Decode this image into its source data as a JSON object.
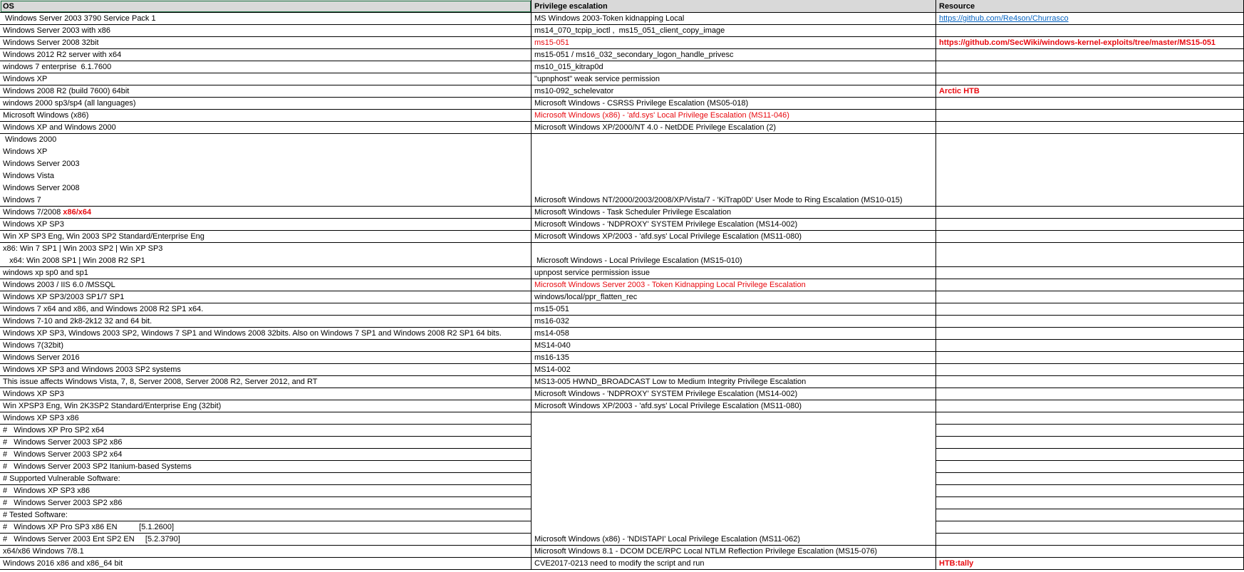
{
  "sheet": {
    "headers": [
      "OS",
      "Privilege escalation",
      "Resource"
    ],
    "rows": [
      {
        "os": [
          " Windows Server 2003 3790 Service Pack 1"
        ],
        "priv": [
          "MS Windows 2003-Token kidnapping Local"
        ],
        "res": [
          "https://github.com/Re4son/Churrasco"
        ],
        "res_style": "link"
      },
      {
        "os": [
          "Windows Server 2003 with x86"
        ],
        "priv": [
          "ms14_070_tcpip_ioctl ,  ms15_051_client_copy_image"
        ]
      },
      {
        "os": [
          "Windows Server 2008 32bit"
        ],
        "priv": [
          "ms15-051"
        ],
        "priv_style": "red",
        "res": [
          "https://github.com/SecWiki/windows-kernel-exploits/tree/master/MS15-051"
        ],
        "res_style": "redb"
      },
      {
        "os": [
          "Windows 2012 R2 server with x64"
        ],
        "priv": [
          "ms15-051 / ms16_032_secondary_logon_handle_privesc"
        ]
      },
      {
        "os": [
          "windows 7 enterprise  6.1.7600"
        ],
        "priv": [
          "ms10_015_kitrap0d"
        ]
      },
      {
        "os": [
          "Windows XP"
        ],
        "priv": [
          "\"upnphost\" weak service permission"
        ]
      },
      {
        "os": [
          "Windows 2008 R2 (build 7600) 64bit"
        ],
        "priv": [
          "ms10-092_schelevator"
        ],
        "res": [
          "Arctic HTB"
        ],
        "res_style": "redb"
      },
      {
        "os": [
          "windows 2000 sp3/sp4 (all languages)"
        ],
        "priv": [
          "Microsoft Windows - CSRSS Privilege Escalation (MS05-018)"
        ]
      },
      {
        "os": [
          "Microsoft Windows (x86)"
        ],
        "priv": [
          "Microsoft Windows (x86) - 'afd.sys' Local Privilege Escalation (MS11-046)"
        ],
        "priv_style": "red"
      },
      {
        "os": [
          "Windows XP and Windows 2000"
        ],
        "priv": [
          "Microsoft Windows XP/2000/NT 4.0 - NetDDE Privilege Escalation (2)"
        ]
      },
      {
        "os": [
          " Windows 2000",
          "Windows XP",
          "Windows Server 2003",
          "Windows Vista",
          "Windows Server 2008",
          "Windows 7"
        ],
        "priv": [
          "Microsoft Windows NT/2000/2003/2008/XP/Vista/7 - 'KiTrap0D' User Mode to Ring Escalation (MS10-015)"
        ],
        "valign": "bottom"
      },
      {
        "os": [
          "Windows 7/2008 "
        ],
        "os_suffix": "x86/x64",
        "priv": [
          "Microsoft Windows - Task Scheduler Privilege Escalation"
        ]
      },
      {
        "os": [
          "Windows XP SP3"
        ],
        "priv": [
          "Microsoft Windows - 'NDPROXY' SYSTEM Privilege Escalation (MS14-002)"
        ]
      },
      {
        "os": [
          "Win XP SP3 Eng, Win 2003 SP2 Standard/Enterprise Eng"
        ],
        "priv": [
          "Microsoft Windows XP/2003 - 'afd.sys' Local Privilege Escalation (MS11-080)"
        ]
      },
      {
        "os": [
          "x86: Win 7 SP1 | Win 2003 SP2 | Win XP SP3",
          "   x64: Win 2008 SP1 | Win 2008 R2 SP1"
        ],
        "priv": [
          " Microsoft Windows - Local Privilege Escalation (MS15-010)"
        ],
        "valign": "bottom"
      },
      {
        "os": [
          "windows xp sp0 and sp1"
        ],
        "priv": [
          "upnpost service permission issue"
        ]
      },
      {
        "os": [
          "Windows 2003 / IIS 6.0 /MSSQL"
        ],
        "priv": [
          "Microsoft Windows Server 2003 - Token Kidnapping Local Privilege Escalation"
        ],
        "priv_style": "red"
      },
      {
        "os": [
          "Windows XP SP3/2003 SP1/7 SP1"
        ],
        "priv": [
          "windows/local/ppr_flatten_rec"
        ]
      },
      {
        "os": [
          "Windows 7 x64 and x86, and Windows 2008 R2 SP1 x64."
        ],
        "priv": [
          "ms15-051"
        ]
      },
      {
        "os": [
          "Windows 7-10 and 2k8-2k12 32 and 64 bit."
        ],
        "priv": [
          "ms16-032"
        ]
      },
      {
        "os": [
          "Windows XP SP3, Windows 2003 SP2, Windows 7 SP1 and Windows 2008 32bits. Also on Windows 7 SP1 and Windows 2008 R2 SP1 64 bits."
        ],
        "priv": [
          "ms14-058"
        ]
      },
      {
        "os": [
          "Windows 7(32bit)"
        ],
        "priv": [
          "MS14-040"
        ]
      },
      {
        "os": [
          "Windows Server 2016"
        ],
        "priv": [
          "ms16-135"
        ]
      },
      {
        "os": [
          "Windows XP SP3 and Windows 2003 SP2 systems"
        ],
        "priv": [
          "MS14-002"
        ]
      },
      {
        "os": [
          "This issue affects Windows Vista, 7, 8, Server 2008, Server 2008 R2, Server 2012, and RT"
        ],
        "priv": [
          "MS13-005 HWND_BROADCAST Low to Medium Integrity Privilege Escalation"
        ]
      },
      {
        "os": [
          "Windows XP SP3"
        ],
        "priv": [
          "Microsoft Windows - 'NDPROXY' SYSTEM Privilege Escalation (MS14-002)"
        ]
      },
      {
        "os": [
          "Win XPSP3 Eng, Win 2K3SP2 Standard/Enterprise Eng (32bit)"
        ],
        "priv": [
          "Microsoft Windows XP/2003 - 'afd.sys' Local Privilege Escalation (MS11-080)"
        ]
      },
      {
        "os": [
          "Windows XP SP3 x86"
        ],
        "priv_span_start": true
      },
      {
        "os": [
          "#   Windows XP Pro SP2 x64"
        ],
        "in_span": true
      },
      {
        "os": [
          "#   Windows Server 2003 SP2 x86"
        ],
        "in_span": true
      },
      {
        "os": [
          "#   Windows Server 2003 SP2 x64"
        ],
        "in_span": true
      },
      {
        "os": [
          "#   Windows Server 2003 SP2 Itanium-based Systems"
        ],
        "in_span": true
      },
      {
        "os": [
          "# Supported Vulnerable Software:"
        ],
        "in_span": true
      },
      {
        "os": [
          "#   Windows XP SP3 x86"
        ],
        "in_span": true
      },
      {
        "os": [
          "#   Windows Server 2003 SP2 x86"
        ],
        "in_span": true
      },
      {
        "os": [
          "# Tested Software:"
        ],
        "in_span": true
      },
      {
        "os": [
          "#   Windows XP Pro SP3 x86 EN          [5.1.2600]"
        ],
        "in_span": true
      },
      {
        "os": [
          "#   Windows Server 2003 Ent SP2 EN     [5.2.3790]"
        ],
        "in_span": true,
        "span_priv": [
          "Microsoft Windows (x86) - 'NDISTAPI' Local Privilege Escalation (MS11-062)"
        ]
      },
      {
        "os": [
          "x64/x86 Windows 7/8.1"
        ],
        "priv": [
          "Microsoft Windows 8.1 - DCOM DCE/RPC Local NTLM Reflection Privilege Escalation (MS15-076)"
        ]
      },
      {
        "os": [
          "Windows 2016 x86 and x86_64 bit"
        ],
        "priv": [
          "CVE2017-0213 need to modify the script and run"
        ],
        "res": [
          "HTB:tally"
        ],
        "res_style": "redb"
      }
    ]
  }
}
